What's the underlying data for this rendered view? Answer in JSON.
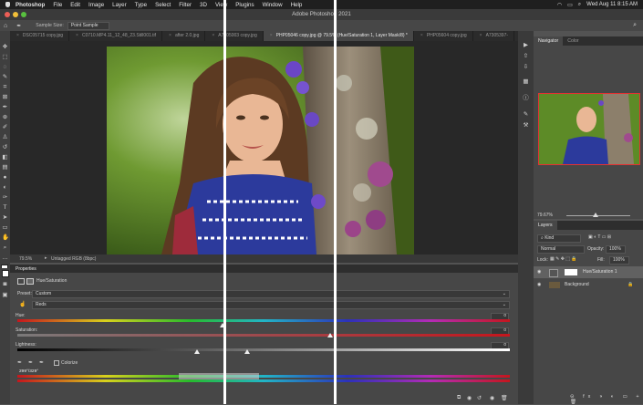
{
  "menubar": {
    "app_name": "Photoshop",
    "items": [
      "File",
      "Edit",
      "Image",
      "Layer",
      "Type",
      "Select",
      "Filter",
      "3D",
      "View",
      "Plugins",
      "Window",
      "Help"
    ],
    "clock": "Wed Aug 11  8:15 AM"
  },
  "window": {
    "title": "Adobe Photoshop 2021"
  },
  "options_bar": {
    "sample_size_label": "Sample Size:",
    "sample_size_value": "Point Sample"
  },
  "tabs": [
    {
      "label": "DSC05715 copy.jpg"
    },
    {
      "label": "C0710.MP4.11_12_48_23.Still001.tif"
    },
    {
      "label": "after 2.0.jpg"
    },
    {
      "label": "A7305003 copy.jpg"
    },
    {
      "label": "PHP05046 copy.jpg @ 79.5% (Hue/Saturation 1, Layer Mask/8) *",
      "active": true
    },
    {
      "label": "PHP05604 copy.jpg"
    },
    {
      "label": "A7305397-"
    }
  ],
  "status_bar": {
    "zoom": "79.5%",
    "info": "Untagged RGB (8bpc)"
  },
  "properties": {
    "panel_title": "Properties",
    "adjustment_name": "Hue/Saturation",
    "preset_label": "Preset:",
    "preset_value": "Custom",
    "channel_value": "Reds",
    "hue_label": "Hue:",
    "hue_value": "0",
    "saturation_label": "Saturation:",
    "saturation_value": "0",
    "lightness_label": "Lightness:",
    "lightness_value": "0",
    "colorize_label": "Colorize",
    "range_readout": "299°/329°"
  },
  "navigator": {
    "tabs": [
      "Navigator",
      "Color"
    ],
    "zoom": "79.67%"
  },
  "layers": {
    "panel_title": "Layers",
    "kind_label": "Kind",
    "blend_mode": "Normal",
    "opacity_label": "Opacity:",
    "opacity_value": "100%",
    "lock_label": "Lock:",
    "fill_label": "Fill:",
    "fill_value": "100%",
    "rows": [
      {
        "name": "Hue/Saturation 1"
      },
      {
        "name": "Background"
      }
    ]
  },
  "colors": {
    "ui_dark": "#282828",
    "panel": "#474747",
    "active_outline": "#e33232"
  },
  "icons": [
    "apple-icon",
    "wifi-icon",
    "battery-icon",
    "search-icon",
    "eyedropper-icon",
    "eye-icon",
    "lock-icon",
    "trash-icon",
    "fx-icon"
  ]
}
